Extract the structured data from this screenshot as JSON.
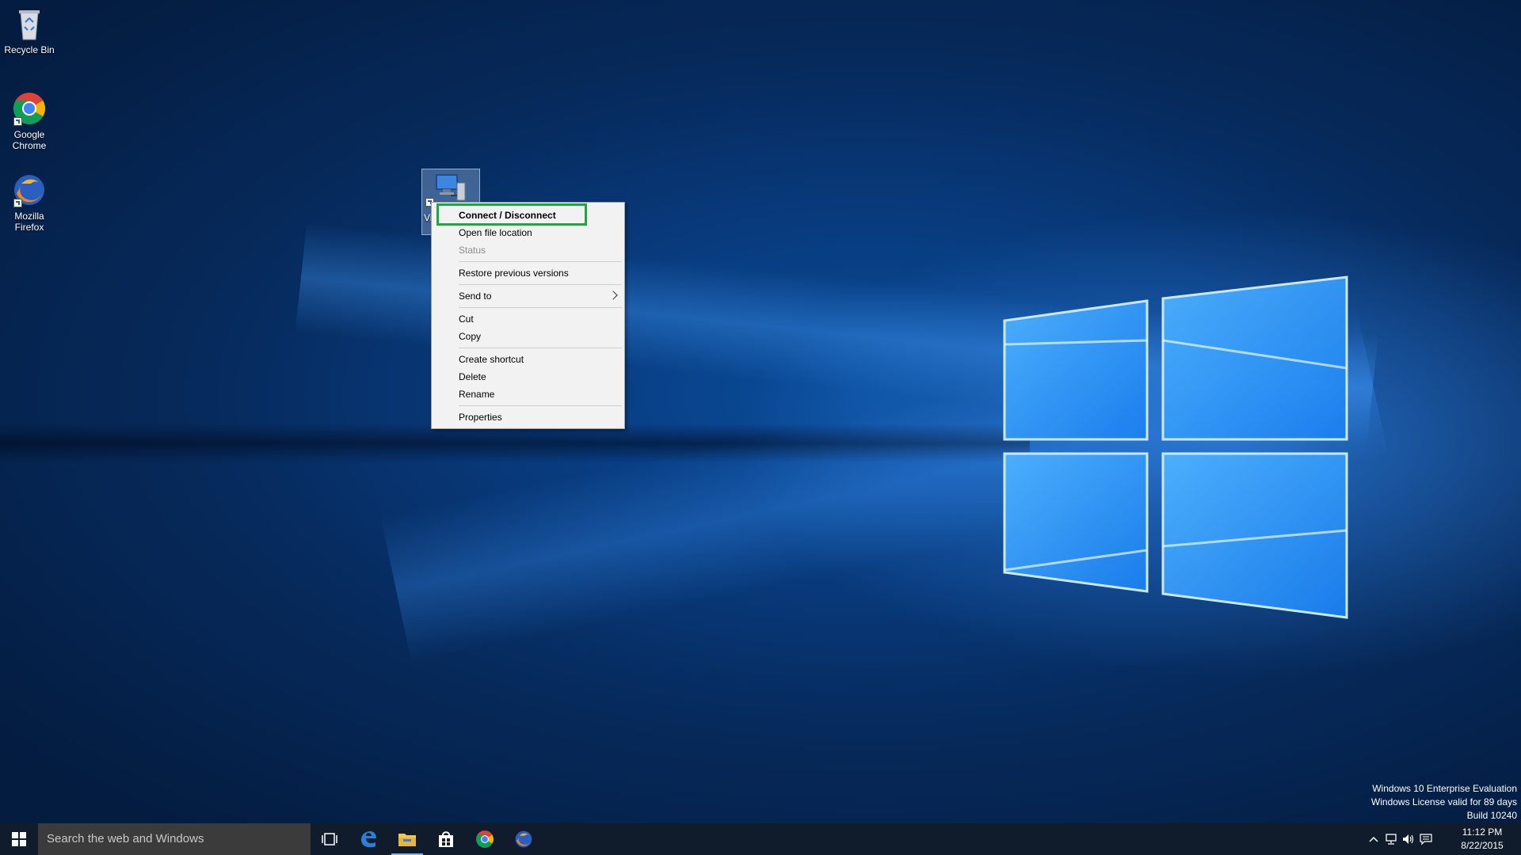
{
  "desktop": {
    "icons": [
      {
        "label": "Recycle Bin"
      },
      {
        "label": "Google\nChrome"
      },
      {
        "label": "Mozilla\nFirefox"
      },
      {
        "label": "Vi"
      }
    ]
  },
  "context_menu": {
    "items": [
      {
        "label": "Connect / Disconnect",
        "bold": true
      },
      {
        "label": "Open file location"
      },
      {
        "label": "Status",
        "disabled": true
      },
      {
        "label": "Restore previous versions"
      },
      {
        "label": "Send to",
        "submenu": true
      },
      {
        "label": "Cut"
      },
      {
        "label": "Copy"
      },
      {
        "label": "Create shortcut"
      },
      {
        "label": "Delete"
      },
      {
        "label": "Rename"
      },
      {
        "label": "Properties"
      }
    ],
    "highlight_color": "#19a93e"
  },
  "watermark": {
    "line1": "Windows 10 Enterprise Evaluation",
    "line2": "Windows License valid for 89 days",
    "line3": "Build 10240"
  },
  "taskbar": {
    "search_placeholder": "Search the web and Windows",
    "pinned": [
      "start-icon",
      "task-view-icon",
      "edge-icon",
      "file-explorer-icon",
      "store-icon",
      "chrome-icon",
      "firefox-icon"
    ],
    "tray": [
      "chevron-up-icon",
      "network-icon",
      "volume-icon",
      "action-center-icon"
    ],
    "clock": {
      "time": "11:12 PM",
      "date": "8/22/2015"
    }
  },
  "colors": {
    "taskbar": "#101c2c",
    "search_bg": "#3b3b3b",
    "menu_bg": "#f2f2f2"
  }
}
